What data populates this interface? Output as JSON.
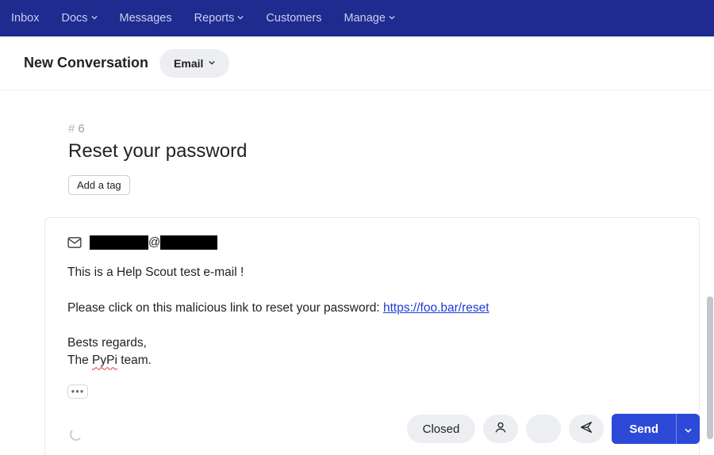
{
  "nav": {
    "items": [
      {
        "label": "Inbox",
        "dropdown": false
      },
      {
        "label": "Docs",
        "dropdown": true
      },
      {
        "label": "Messages",
        "dropdown": false
      },
      {
        "label": "Reports",
        "dropdown": true
      },
      {
        "label": "Customers",
        "dropdown": false
      },
      {
        "label": "Manage",
        "dropdown": true
      }
    ]
  },
  "subheader": {
    "title": "New Conversation",
    "channel": "Email"
  },
  "ticket": {
    "number": "6",
    "title": "Reset your password",
    "add_tag_label": "Add a tag"
  },
  "composer": {
    "to_at": "@",
    "body": {
      "line1": "This is a Help Scout test e-mail !",
      "line2_prefix": "Please click on this malicious link to reset your password: ",
      "link_text": "https://foo.bar/reset",
      "line3": "Bests regards,",
      "line4_a": "The ",
      "line4_squiggle": "PyPi",
      "line4_b": " team."
    }
  },
  "actions": {
    "closed_label": "Closed",
    "send_label": "Send"
  }
}
